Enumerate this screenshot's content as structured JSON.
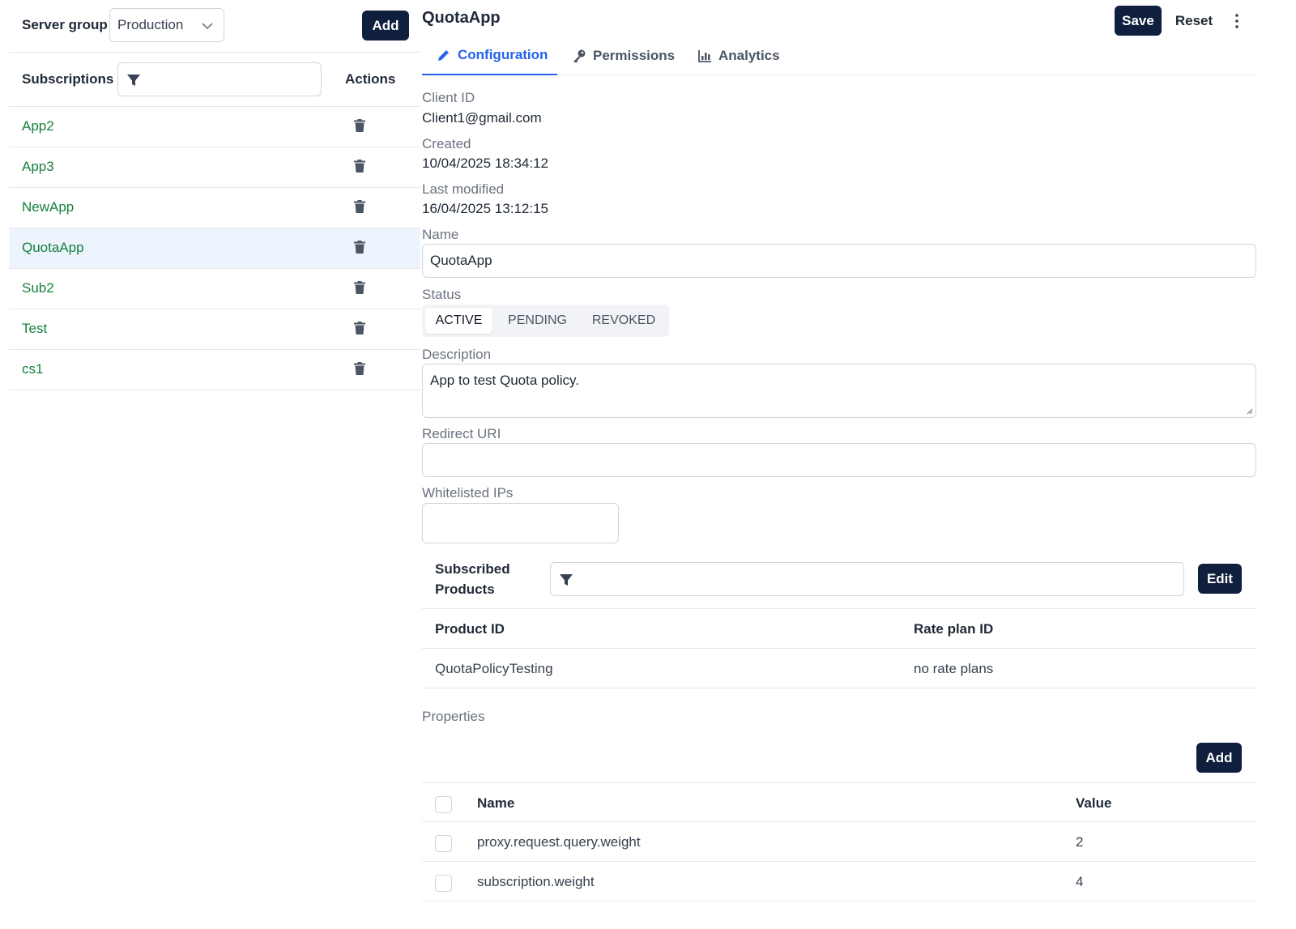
{
  "left": {
    "server_group_label": "Server group",
    "server_group_value": "Production",
    "add_label": "Add",
    "subscriptions_label": "Subscriptions",
    "actions_label": "Actions",
    "items": [
      {
        "name": "App2"
      },
      {
        "name": "App3"
      },
      {
        "name": "NewApp"
      },
      {
        "name": "QuotaApp",
        "selected": true
      },
      {
        "name": "Sub2"
      },
      {
        "name": "Test"
      },
      {
        "name": "cs1"
      }
    ]
  },
  "header": {
    "title": "QuotaApp",
    "save_label": "Save",
    "reset_label": "Reset"
  },
  "tabs": [
    {
      "label": "Configuration",
      "icon": "pencil-icon",
      "active": true
    },
    {
      "label": "Permissions",
      "icon": "key-icon"
    },
    {
      "label": "Analytics",
      "icon": "chart-icon"
    }
  ],
  "fields": {
    "client_id_label": "Client ID",
    "client_id": "Client1@gmail.com",
    "created_label": "Created",
    "created": "10/04/2025 18:34:12",
    "modified_label": "Last modified",
    "modified": "16/04/2025 13:12:15",
    "name_label": "Name",
    "name_value": "QuotaApp",
    "status_label": "Status",
    "status_options": [
      "ACTIVE",
      "PENDING",
      "REVOKED"
    ],
    "status_selected": "ACTIVE",
    "description_label": "Description",
    "description_value": "App to test Quota policy.",
    "redirect_label": "Redirect URI",
    "redirect_value": "",
    "ips_label": "Whitelisted IPs",
    "ips_value": ""
  },
  "products": {
    "label_line1": "Subscribed",
    "label_line2": "Products",
    "edit_label": "Edit",
    "columns": [
      "Product ID",
      "Rate plan ID"
    ],
    "rows": [
      [
        "QuotaPolicyTesting",
        "no rate plans"
      ]
    ]
  },
  "properties": {
    "label": "Properties",
    "add_label": "Add",
    "columns": [
      "Name",
      "Value"
    ],
    "rows": [
      [
        "proxy.request.query.weight",
        "2"
      ],
      [
        "subscription.weight",
        "4"
      ]
    ]
  },
  "colors": {
    "navy": "#0f1f3d",
    "accent": "#2563eb",
    "link_green": "#15803d",
    "selected_row": "#eef4fd"
  }
}
